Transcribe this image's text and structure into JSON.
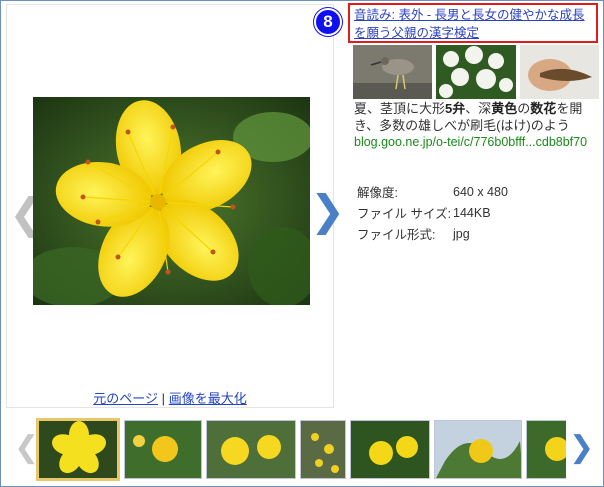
{
  "badge": {
    "number": "8"
  },
  "title": {
    "text": "音読み: 表外 - 長男と長女の健やかな成長を願う父親の漢字検定"
  },
  "snippet": {
    "pre": "夏、茎頂に大形",
    "b1": "5弁",
    "mid1": "、深",
    "b2": "黄色",
    "mid2": "の",
    "b3": "数花",
    "post": "を開き、多数の雄しべが刷毛(はけ)のよう"
  },
  "source": {
    "url": "blog.goo.ne.jp/o-tei/c/776b0bfff...cdb8bf70"
  },
  "meta": {
    "rows": [
      {
        "label": "解像度:",
        "value": "640 x 480"
      },
      {
        "label": "ファイル サイズ:",
        "value": "144KB"
      },
      {
        "label": "ファイル形式:",
        "value": "jpg"
      }
    ]
  },
  "links": {
    "original_page": "元のページ",
    "separator": "|",
    "maximize": "画像を最大化"
  },
  "icons": {
    "prev": "chevron-left-icon",
    "next": "chevron-right-icon"
  },
  "colors": {
    "link": "#2345c7",
    "highlight_border": "#e31b1b",
    "badge": "#1010ee",
    "source": "#1a8a1a"
  }
}
